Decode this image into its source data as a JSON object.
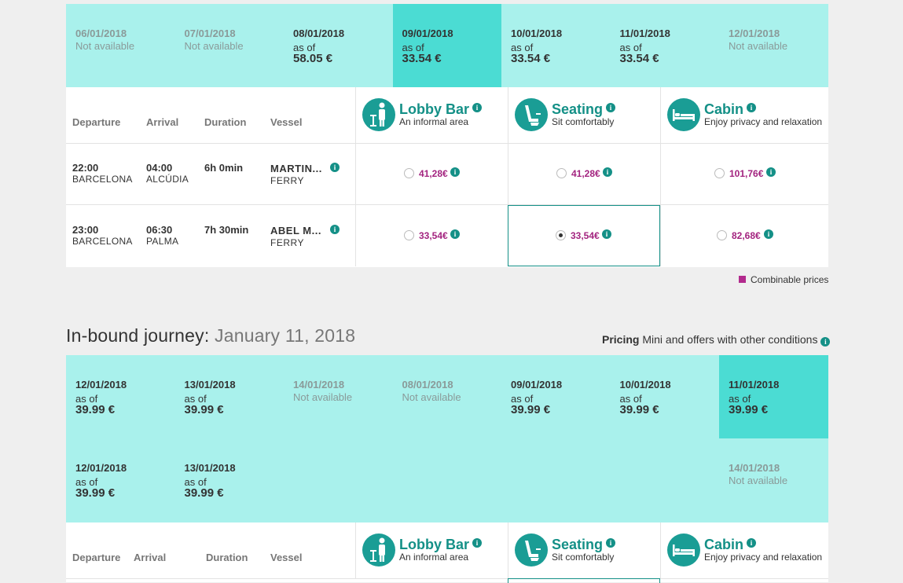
{
  "outbound": {
    "dates": [
      {
        "date": "06/01/2018",
        "status": "Not available",
        "available": false
      },
      {
        "date": "07/01/2018",
        "status": "Not available",
        "available": false
      },
      {
        "date": "08/01/2018",
        "asof": "as of",
        "price": "58.05 €",
        "available": true
      },
      {
        "date": "09/01/2018",
        "asof": "as of",
        "price": "33.54 €",
        "available": true,
        "selected": true
      },
      {
        "date": "10/01/2018",
        "asof": "as of",
        "price": "33.54 €",
        "available": true
      },
      {
        "date": "11/01/2018",
        "asof": "as of",
        "price": "33.54 €",
        "available": true
      },
      {
        "date": "12/01/2018",
        "status": "Not available",
        "available": false
      }
    ],
    "headers": {
      "departure": "Departure",
      "arrival": "Arrival",
      "duration": "Duration",
      "vessel": "Vessel"
    },
    "classes": [
      {
        "name": "Lobby Bar",
        "desc": "An informal area",
        "icon": "lobby-bar-icon"
      },
      {
        "name": "Seating",
        "desc": "Sit comfortably",
        "icon": "seat-icon"
      },
      {
        "name": "Cabin",
        "desc": "Enjoy privacy and relaxation",
        "icon": "bed-icon"
      }
    ],
    "rows": [
      {
        "dep_time": "22:00",
        "dep_port": "BARCELONA",
        "arr_time": "04:00",
        "arr_port": "ALCÚDIA",
        "duration": "6h 0min",
        "vessel": "MARTIN...",
        "vessel_type": "FERRY",
        "fares": [
          "41,28€",
          "41,28€",
          "101,76€"
        ]
      },
      {
        "dep_time": "23:00",
        "dep_port": "BARCELONA",
        "arr_time": "06:30",
        "arr_port": "PALMA",
        "duration": "7h 30min",
        "vessel": "ABEL M...",
        "vessel_type": "FERRY",
        "fares": [
          "33,54€",
          "33,54€",
          "82,68€"
        ]
      }
    ],
    "legend": "Combinable prices"
  },
  "inbound": {
    "title": "In-bound journey:",
    "date": "January 11, 2018",
    "pricing_label": "Pricing",
    "pricing_text": "Mini and offers with other conditions",
    "dates_row1": [
      {
        "date": "12/01/2018",
        "asof": "as of",
        "price": "39.99 €",
        "available": true
      },
      {
        "date": "13/01/2018",
        "asof": "as of",
        "price": "39.99 €",
        "available": true
      },
      {
        "date": "14/01/2018",
        "status": "Not available",
        "available": false
      },
      {
        "date": "08/01/2018",
        "status": "Not available",
        "available": false
      },
      {
        "date": "09/01/2018",
        "asof": "as of",
        "price": "39.99 €",
        "available": true
      },
      {
        "date": "10/01/2018",
        "asof": "as of",
        "price": "39.99 €",
        "available": true
      },
      {
        "date": "11/01/2018",
        "asof": "as of",
        "price": "39.99 €",
        "available": true,
        "selected": true
      }
    ],
    "dates_row2": [
      {
        "date": "12/01/2018",
        "asof": "as of",
        "price": "39.99 €",
        "available": true
      },
      {
        "date": "13/01/2018",
        "asof": "as of",
        "price": "39.99 €",
        "available": true
      },
      {
        "date": "14/01/2018",
        "status": "Not available",
        "available": false
      }
    ],
    "headers": {
      "departure": "Departure",
      "arrival": "Arrival",
      "duration": "Duration",
      "vessel": "Vessel"
    },
    "classes": [
      {
        "name": "Lobby Bar",
        "desc": "An informal area",
        "icon": "lobby-bar-icon"
      },
      {
        "name": "Seating",
        "desc": "Sit comfortably",
        "icon": "seat-icon"
      },
      {
        "name": "Cabin",
        "desc": "Enjoy privacy and relaxation",
        "icon": "bed-icon"
      }
    ]
  },
  "colors": {
    "strip": "#a9f1ec",
    "selected": "#4bdcd3",
    "accent": "#149087",
    "price": "#a3237f"
  }
}
